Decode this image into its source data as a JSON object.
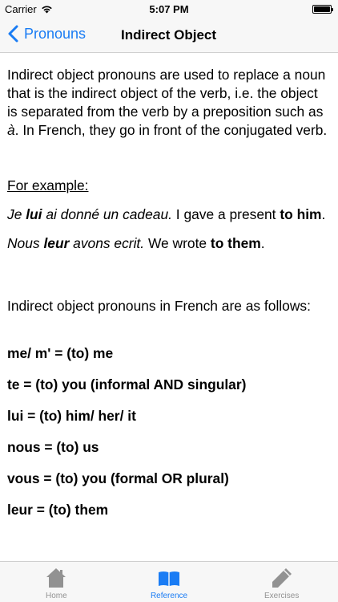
{
  "status_bar": {
    "carrier": "Carrier",
    "time": "5:07 PM",
    "battery_level": 1.0
  },
  "nav": {
    "back_label": "Pronouns",
    "title": "Indirect Object"
  },
  "content": {
    "intro": "Indirect object pronouns are used to replace a noun that is the indirect object of the verb, i.e. the object is separated from the verb by a preposition such as ",
    "intro_italic": "à",
    "intro_end": ". In French, they go in front of the conjugated verb.",
    "example_label": "For example:",
    "ex1": {
      "fr_a": "Je ",
      "fr_bold": "lui",
      "fr_b": " ai donné un cadeau.",
      "en_a": " I gave a present ",
      "en_bold": "to him",
      "en_b": "."
    },
    "ex2": {
      "fr_a": "Nous ",
      "fr_bold": "leur",
      "fr_b": " avons ecrit.",
      "en_a": " We wrote ",
      "en_bold": "to them",
      "en_b": "."
    },
    "list_intro": "Indirect object pronouns in French are as follows:",
    "pronouns": [
      "me/ m' = (to) me",
      "te  = (to) you (informal AND singular)",
      "lui = (to) him/ her/ it",
      "nous = (to) us",
      "vous = (to) you (formal OR plural)",
      "leur = (to) them"
    ]
  },
  "tabs": [
    {
      "label": "Home",
      "icon": "house-icon",
      "active": false
    },
    {
      "label": "Reference",
      "icon": "book-icon",
      "active": true
    },
    {
      "label": "Exercises",
      "icon": "pencil-icon",
      "active": false
    }
  ],
  "colors": {
    "accent": "#1a7cf4",
    "inactive": "#929292",
    "bar_bg": "#f7f7f7"
  }
}
